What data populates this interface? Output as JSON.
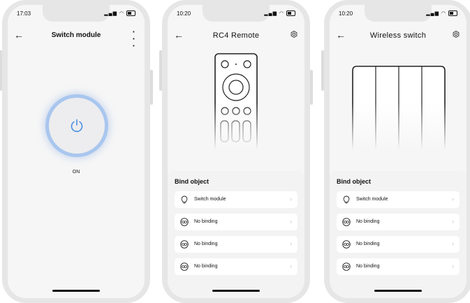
{
  "phone1": {
    "time": "17:03",
    "title": "Switch module",
    "power_state": "ON"
  },
  "phone2": {
    "time": "10:20",
    "title": "RC4 Remote",
    "bind_title": "Bind object",
    "items": [
      {
        "label": "Switch module",
        "icon": "bulb-icon"
      },
      {
        "label": "No binding",
        "icon": "link-icon"
      },
      {
        "label": "No binding",
        "icon": "link-icon"
      },
      {
        "label": "No binding",
        "icon": "link-icon"
      }
    ]
  },
  "phone3": {
    "time": "10:20",
    "title": "Wireless switch",
    "bind_title": "Bind object",
    "items": [
      {
        "label": "Switch module",
        "icon": "bulb-icon"
      },
      {
        "label": "No binding",
        "icon": "link-icon"
      },
      {
        "label": "No binding",
        "icon": "link-icon"
      },
      {
        "label": "No binding",
        "icon": "link-icon"
      }
    ]
  },
  "icons": {
    "back": "arrow-left-icon",
    "more": "kebab-icon",
    "settings": "gear-icon",
    "chevron": "chevron-right-icon",
    "power": "power-icon"
  },
  "colors": {
    "power_ring": "#a9c6ee",
    "power_icon": "#4a8fe0",
    "background": "#f6f6f6"
  }
}
